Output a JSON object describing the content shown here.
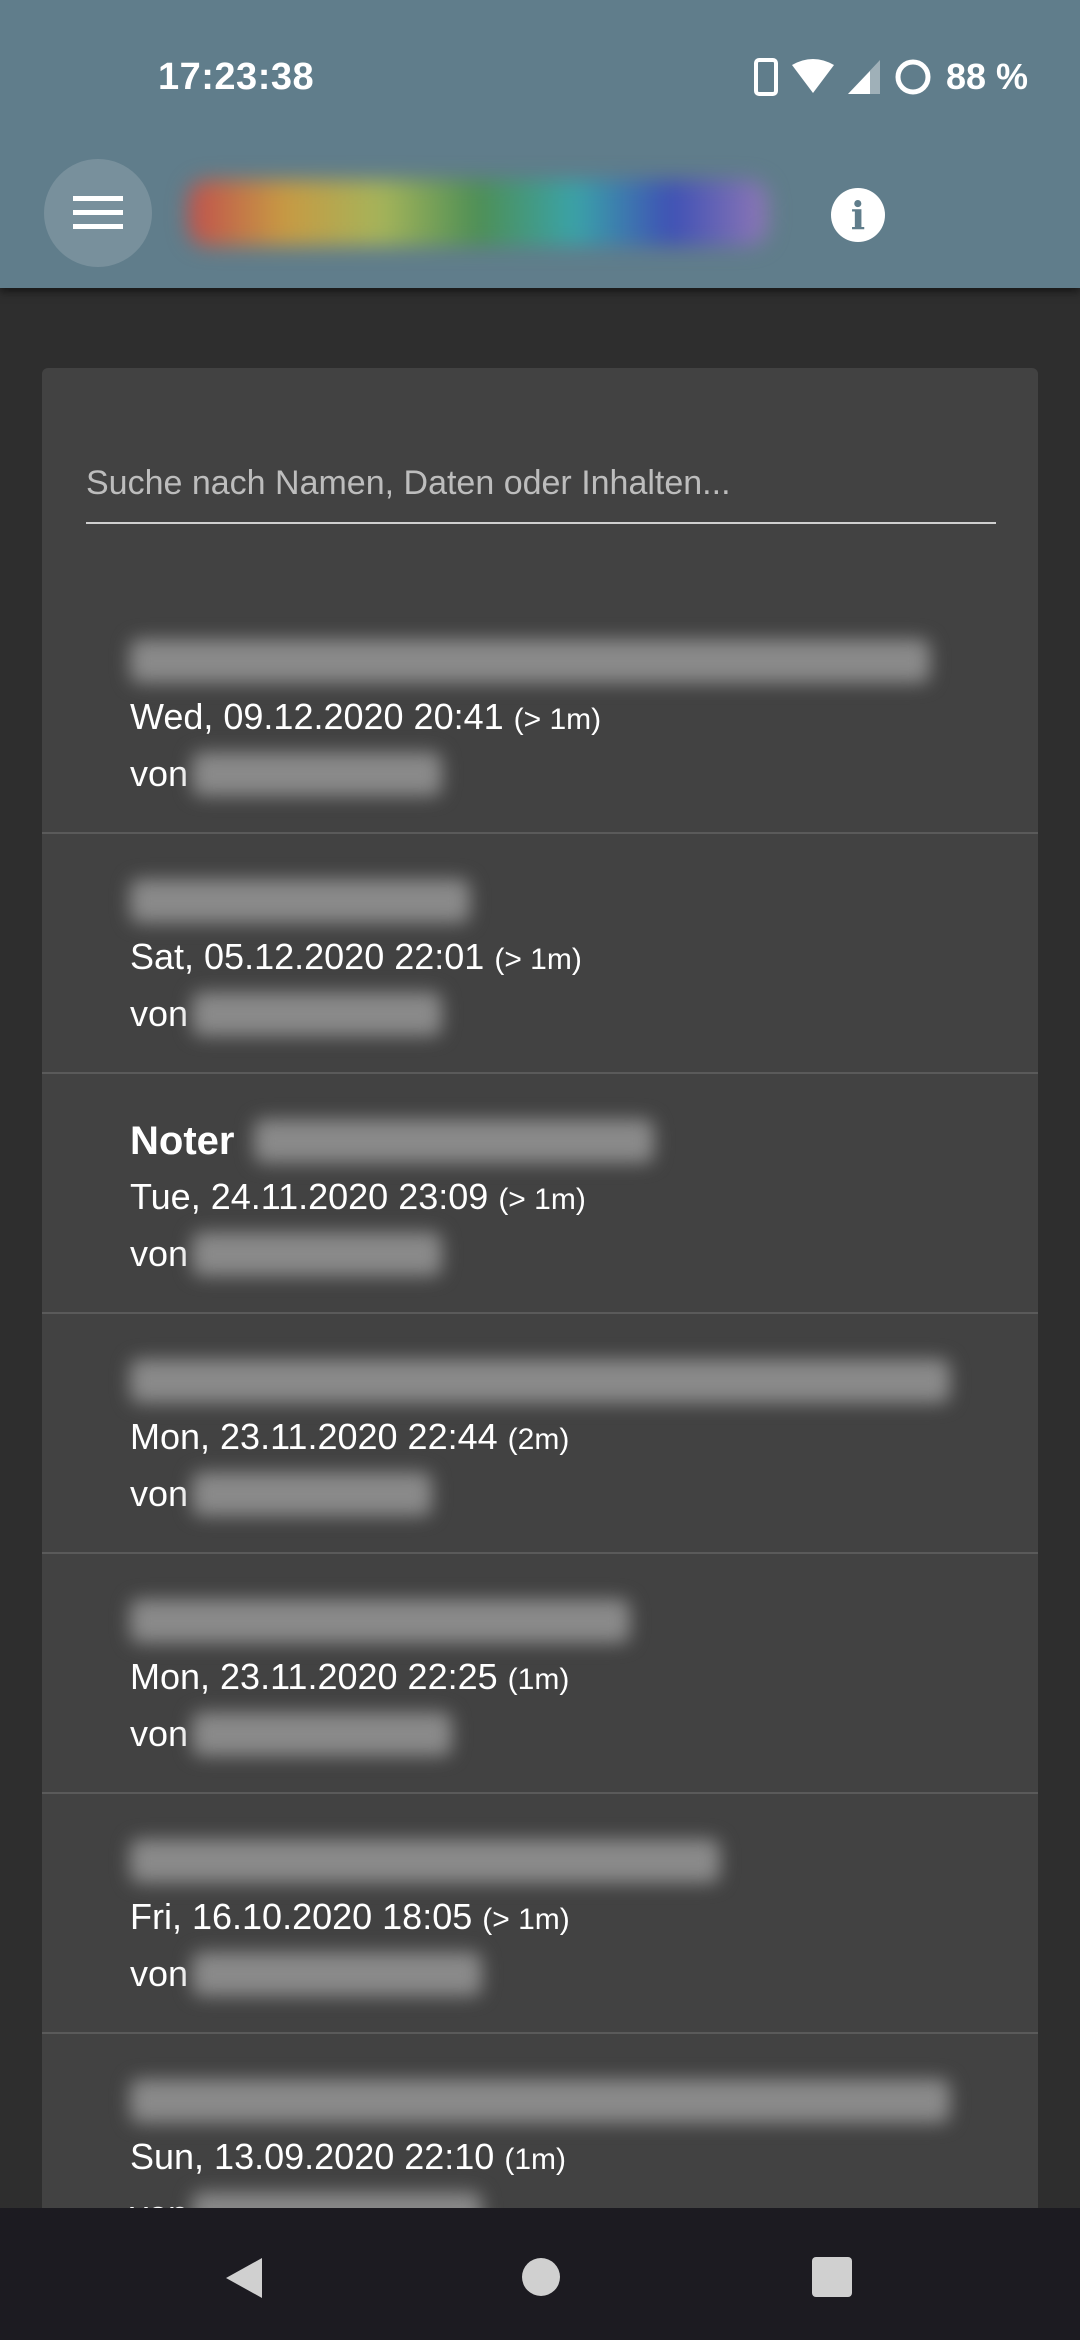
{
  "status_bar": {
    "time": "17:23:38",
    "battery": "88 %"
  },
  "app_bar": {
    "menu_icon": "hamburger-icon",
    "info_icon": "info-icon"
  },
  "search": {
    "placeholder": "Suche nach Namen, Daten oder Inhalten..."
  },
  "items": [
    {
      "title": "",
      "date": "Wed, 09.12.2020 20:41",
      "duration": "(> 1m)",
      "by": "von"
    },
    {
      "title": "",
      "date": "Sat, 05.12.2020 22:01",
      "duration": "(> 1m)",
      "by": "von"
    },
    {
      "title": "Noter",
      "date": "Tue, 24.11.2020 23:09",
      "duration": "(> 1m)",
      "by": "von"
    },
    {
      "title": "",
      "date": "Mon, 23.11.2020 22:44",
      "duration": "(2m)",
      "by": "von"
    },
    {
      "title": "",
      "date": "Mon, 23.11.2020 22:25",
      "duration": "(1m)",
      "by": "von"
    },
    {
      "title": "",
      "date": "Fri, 16.10.2020 18:05",
      "duration": "(> 1m)",
      "by": "von"
    },
    {
      "title": "",
      "date": "Sun, 13.09.2020 22:10",
      "duration": "(1m)",
      "by": "von"
    }
  ],
  "colors": {
    "app_bar": "#607d8b",
    "card": "#424242",
    "background": "#2e2e2e"
  }
}
